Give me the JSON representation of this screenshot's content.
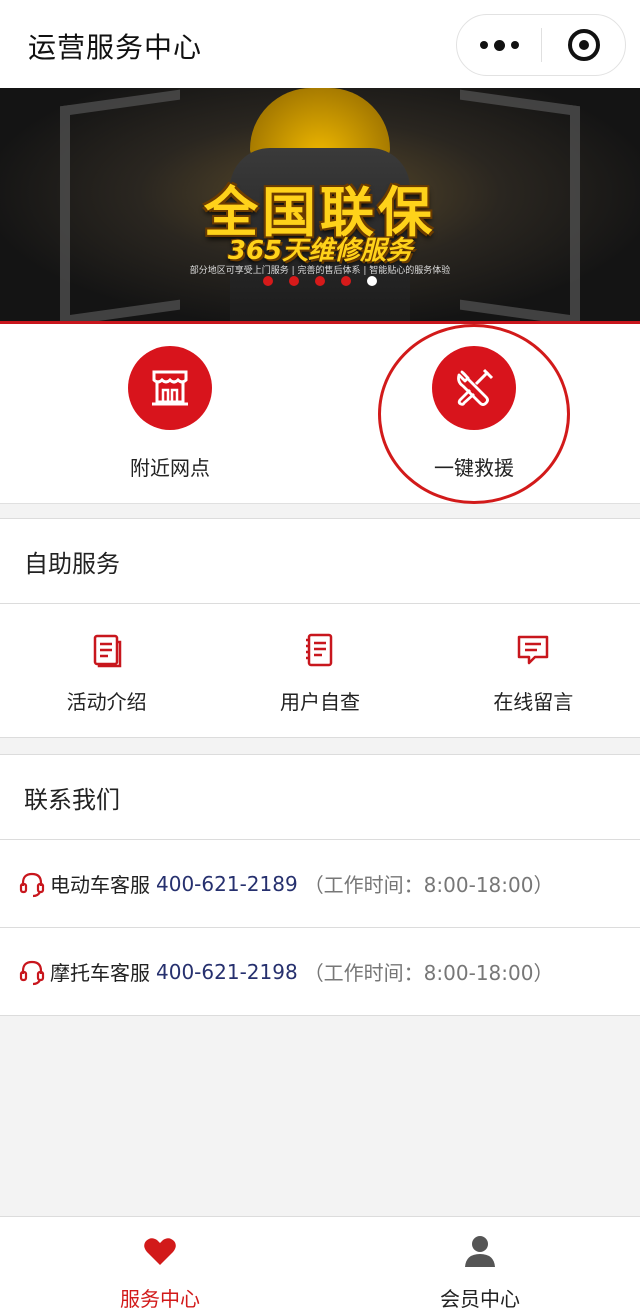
{
  "header": {
    "title": "运营服务中心",
    "more_icon": "more-dots-icon",
    "close_icon": "target-close-icon"
  },
  "banner": {
    "headline": "全国联保",
    "subheadline": "365天维修服务",
    "note": "部分地区可享受上门服务 | 完善的售后体系 | 智能贴心的服务体验",
    "slides_count": 5,
    "active_slide": 5
  },
  "quick_actions": [
    {
      "label": "附近网点",
      "icon": "store-icon"
    },
    {
      "label": "一键救援",
      "icon": "wrench-tools-icon"
    }
  ],
  "self_service": {
    "title": "自助服务",
    "items": [
      {
        "label": "活动介绍",
        "icon": "document-icon"
      },
      {
        "label": "用户自查",
        "icon": "checklist-icon"
      },
      {
        "label": "在线留言",
        "icon": "message-icon"
      }
    ]
  },
  "contact": {
    "title": "联系我们",
    "items": [
      {
        "name": "电动车客服",
        "phone": "400-621-2189",
        "hours": "（工作时间：8:00-18:00）",
        "icon": "headset-icon"
      },
      {
        "name": "摩托车客服",
        "phone": "400-621-2198",
        "hours": "（工作时间：8:00-18:00）",
        "icon": "headset-icon"
      }
    ]
  },
  "tabbar": {
    "tabs": [
      {
        "label": "服务中心",
        "icon": "heart-icon",
        "active": true
      },
      {
        "label": "会员中心",
        "icon": "user-icon",
        "active": false
      }
    ]
  },
  "colors": {
    "accent": "#d8141c",
    "phone": "#26306e"
  }
}
